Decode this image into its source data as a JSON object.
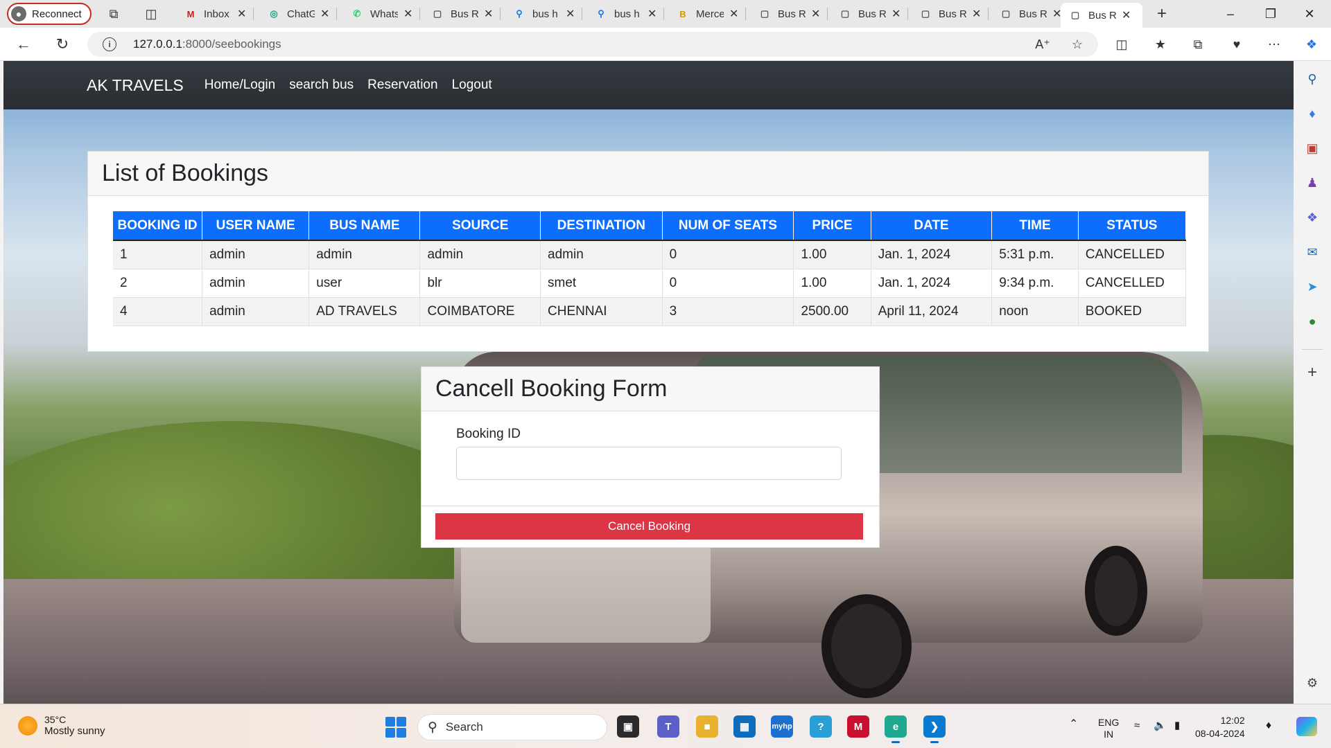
{
  "browser": {
    "profile_label": "Reconnect",
    "tabs": [
      {
        "title": "Inbox",
        "icon": "gmail-icon",
        "fav": "M",
        "color": "#c5221f"
      },
      {
        "title": "ChatGPT",
        "icon": "chatgpt-icon",
        "fav": "◎",
        "color": "#10a37f"
      },
      {
        "title": "WhatsApp",
        "icon": "whatsapp-icon",
        "fav": "✆",
        "color": "#25d366"
      },
      {
        "title": "Bus Reservation",
        "icon": "page-icon",
        "fav": "▢",
        "color": "#555555"
      },
      {
        "title": "bus h",
        "icon": "search-icon",
        "fav": "⚲",
        "color": "#1a73e8"
      },
      {
        "title": "bus h",
        "icon": "search-icon",
        "fav": "⚲",
        "color": "#1a73e8"
      },
      {
        "title": "Mercedes",
        "icon": "brand-icon",
        "fav": "B",
        "color": "#d39a00"
      },
      {
        "title": "Bus Reservation",
        "icon": "page-icon",
        "fav": "▢",
        "color": "#555555"
      },
      {
        "title": "Bus Reservation",
        "icon": "page-icon",
        "fav": "▢",
        "color": "#555555"
      },
      {
        "title": "Bus Reservation",
        "icon": "page-icon",
        "fav": "▢",
        "color": "#555555"
      },
      {
        "title": "Bus Reservation",
        "icon": "page-icon",
        "fav": "▢",
        "color": "#555555"
      },
      {
        "title": "Bus Reservation",
        "icon": "page-icon",
        "fav": "▢",
        "color": "#555555",
        "active": true
      }
    ],
    "url_host": "127.0.0.1",
    "url_path": ":8000/seebookings"
  },
  "navbar": {
    "brand": "AK TRAVELS",
    "links": [
      "Home/Login",
      "search bus",
      "Reservation",
      "Logout"
    ]
  },
  "bookings": {
    "title": "List of Bookings",
    "columns": [
      "BOOKING ID",
      "USER NAME",
      "BUS NAME",
      "SOURCE",
      "DESTINATION",
      "NUM OF SEATS",
      "PRICE",
      "DATE",
      "TIME",
      "STATUS"
    ],
    "rows": [
      [
        "1",
        "admin",
        "admin",
        "admin",
        "admin",
        "0",
        "1.00",
        "Jan. 1, 2024",
        "5:31 p.m.",
        "CANCELLED"
      ],
      [
        "2",
        "admin",
        "user",
        "blr",
        "smet",
        "0",
        "1.00",
        "Jan. 1, 2024",
        "9:34 p.m.",
        "CANCELLED"
      ],
      [
        "4",
        "admin",
        "AD TRAVELS",
        "COIMBATORE",
        "CHENNAI",
        "3",
        "2500.00",
        "April 11, 2024",
        "noon",
        "BOOKED"
      ]
    ]
  },
  "cancel_form": {
    "title": "Cancell Booking Form",
    "field_label": "Booking ID",
    "field_value": "",
    "submit_label": "Cancel Booking"
  },
  "taskbar": {
    "weather_temp": "35°C",
    "weather_desc": "Mostly sunny",
    "search_placeholder": "Search",
    "lang_top": "ENG",
    "lang_bottom": "IN",
    "time": "12:02",
    "date": "08-04-2024"
  },
  "colors": {
    "primary": "#0d6efd",
    "danger": "#dc3545",
    "navbar": "#343a40"
  }
}
